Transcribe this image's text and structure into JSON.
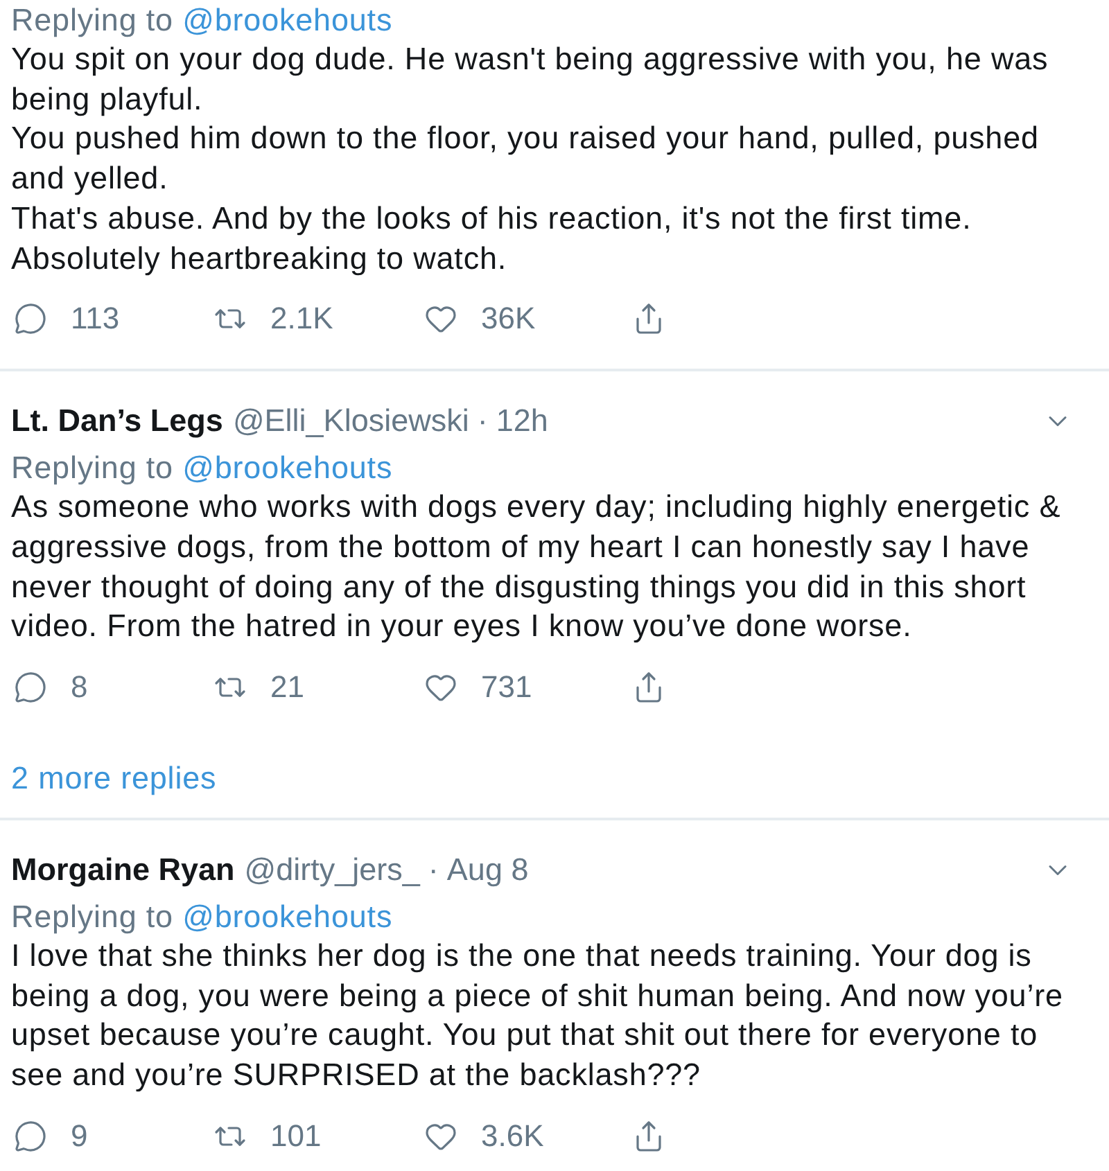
{
  "replies": [
    {
      "replying_to": {
        "label": "Replying to",
        "handle": "@brookehouts"
      },
      "text": "You spit on your dog dude. He wasn't being aggressive with you, he was being playful.\nYou pushed him down to the floor, you raised your hand, pulled, pushed and yelled.\nThat's abuse. And by the looks of his reaction, it's not the first time.\nAbsolutely heartbreaking to watch.",
      "actions": [
        {
          "kind": "reply",
          "count": "113"
        },
        {
          "kind": "retweet",
          "count": "2.1K"
        },
        {
          "kind": "like",
          "count": "36K"
        },
        {
          "kind": "share"
        }
      ]
    },
    {
      "author": {
        "name": "Lt. Dan’s Legs",
        "handle": "@Elli_Klosiewski",
        "separator": "·",
        "time": "12h"
      },
      "replying_to": {
        "label": "Replying to",
        "handle": "@brookehouts"
      },
      "text": "As someone who works with dogs every day; including highly energetic & aggressive dogs, from the bottom of my heart I can honestly say I have never thought of doing any of the disgusting things you did in this short video. From the hatred in your eyes I know you’ve done worse.",
      "actions": [
        {
          "kind": "reply",
          "count": "8"
        },
        {
          "kind": "retweet",
          "count": "21"
        },
        {
          "kind": "like",
          "count": "731"
        },
        {
          "kind": "share"
        }
      ],
      "more_replies": "2 more replies"
    },
    {
      "author": {
        "name": "Morgaine Ryan",
        "handle": "@dirty_jers_",
        "separator": "·",
        "time": "Aug 8"
      },
      "replying_to": {
        "label": "Replying to",
        "handle": "@brookehouts"
      },
      "text": "I love that she thinks her dog is the one that needs training. Your dog is being a dog, you were being a piece of shit human being. And now you’re upset because you’re caught. You put that shit out there for everyone to see and you’re SURPRISED at the backlash???",
      "actions": [
        {
          "kind": "reply",
          "count": "9"
        },
        {
          "kind": "retweet",
          "count": "101"
        },
        {
          "kind": "like",
          "count": "3.6K"
        },
        {
          "kind": "share"
        }
      ]
    }
  ]
}
